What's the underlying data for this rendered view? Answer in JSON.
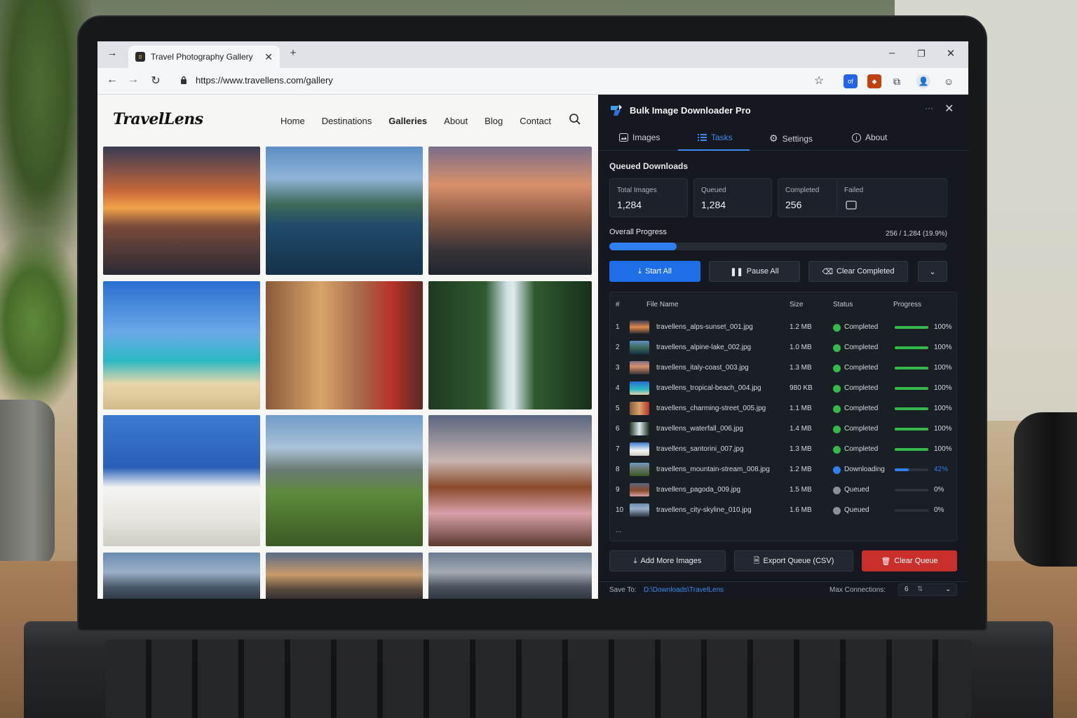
{
  "browser": {
    "tab_title": "Travel Photography Gallery",
    "url": "https://www.travellens.com/gallery",
    "icons": [
      "forward-icon",
      "close-icon",
      "new-tab-icon",
      "minimize-icon",
      "restore-icon",
      "window-close-icon",
      "back-icon",
      "refresh-icon",
      "star-icon",
      "profile-icon"
    ]
  },
  "site": {
    "logo": "TravelLens",
    "nav": [
      "Home",
      "Destinations",
      "Galleries",
      "About",
      "Blog",
      "Contact"
    ],
    "active_nav": "Galleries"
  },
  "panel": {
    "title": "Bulk Image Downloader Pro",
    "more": "···",
    "tabs": [
      "Images",
      "Tasks",
      "Settings",
      "About"
    ],
    "active_tab": "Tasks",
    "section_title": "Queued Downloads",
    "stats": [
      {
        "label": "Total Images",
        "value": "1,284"
      },
      {
        "label": "Queued",
        "value": "1,284"
      },
      {
        "label": "Completed",
        "value": "256"
      },
      {
        "label": "Failed",
        "value": ""
      }
    ],
    "overall_label": "Overall Progress",
    "overall_value": "256 / 1,284 (19.9%)",
    "overall_fraction": 0.199,
    "buttons": {
      "start": "Start All",
      "pause": "Pause All",
      "clear_completed": "Clear Completed"
    },
    "columns": [
      "#",
      "File Name",
      "Size",
      "Status",
      "Progress"
    ],
    "rows": [
      {
        "n": "1",
        "file": "travellens_alps-sunset_001.jpg",
        "size": "1.2 MB",
        "status": "Completed",
        "progress": "100%",
        "pct": 1.0
      },
      {
        "n": "2",
        "file": "travellens_alpine-lake_002.jpg",
        "size": "1.0 MB",
        "status": "Completed",
        "progress": "100%",
        "pct": 1.0
      },
      {
        "n": "3",
        "file": "travellens_italy-coast_003.jpg",
        "size": "1.3 MB",
        "status": "Completed",
        "progress": "100%",
        "pct": 1.0
      },
      {
        "n": "4",
        "file": "travellens_tropical-beach_004.jpg",
        "size": "980 KB",
        "status": "Completed",
        "progress": "100%",
        "pct": 1.0
      },
      {
        "n": "5",
        "file": "travellens_charming-street_005.jpg",
        "size": "1.1 MB",
        "status": "Completed",
        "progress": "100%",
        "pct": 1.0
      },
      {
        "n": "6",
        "file": "travellens_waterfall_006.jpg",
        "size": "1.4 MB",
        "status": "Completed",
        "progress": "100%",
        "pct": 1.0
      },
      {
        "n": "7",
        "file": "travellens_santorini_007.jpg",
        "size": "1.3 MB",
        "status": "Completed",
        "progress": "100%",
        "pct": 1.0
      },
      {
        "n": "8",
        "file": "travellens_mountain-stream_008.jpg",
        "size": "1.2 MB",
        "status": "Downloading",
        "progress": "42%",
        "pct": 0.42
      },
      {
        "n": "9",
        "file": "travellens_pagoda_009.jpg",
        "size": "1.5 MB",
        "status": "Queued",
        "progress": "0%",
        "pct": 0.0
      },
      {
        "n": "10",
        "file": "travellens_city-skyline_010.jpg",
        "size": "1.6 MB",
        "status": "Queued",
        "progress": "0%",
        "pct": 0.0
      }
    ],
    "ellipsis": "...",
    "footer_buttons": {
      "add": "Add More Images",
      "export": "Export Queue (CSV)",
      "clear_queue": "Clear Queue"
    },
    "save_to_label": "Save To:",
    "save_to_value": "D:\\Downloads\\TravelLens",
    "max_conn_label": "Max Connections:",
    "max_conn_value": "6"
  },
  "colors": {
    "accent": "#2f7ff0",
    "completed": "#34b94a",
    "downloading": "#2f7ff0",
    "queued": "#8c9199",
    "danger": "#c9302c"
  }
}
